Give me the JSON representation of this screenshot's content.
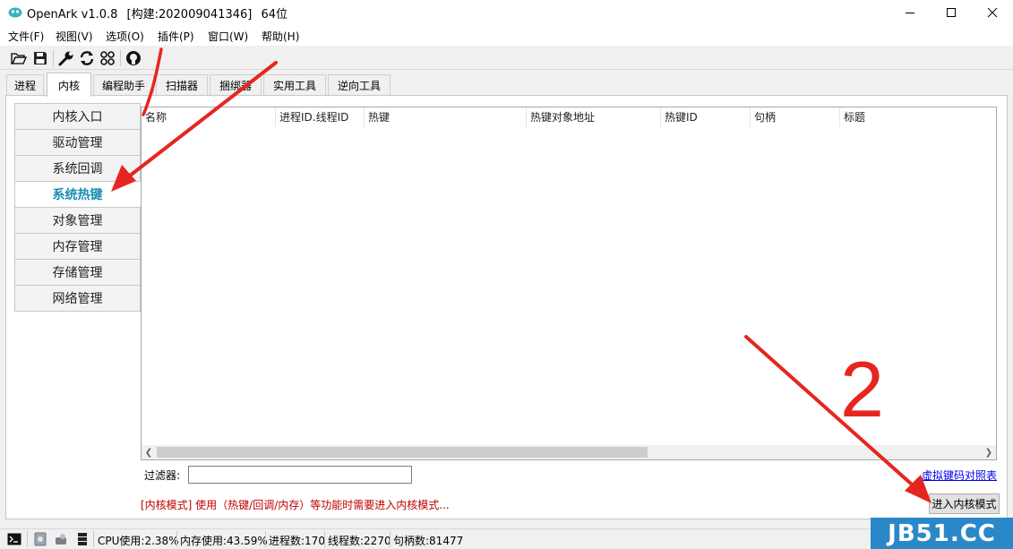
{
  "window": {
    "app_name": "OpenArk v1.0.8",
    "build": "[构建:202009041346]",
    "arch": "64位"
  },
  "menu": [
    "文件(F)",
    "视图(V)",
    "选项(O)",
    "插件(P)",
    "窗口(W)",
    "帮助(H)"
  ],
  "toolbar": {
    "icons": [
      "folder-open-icon",
      "save-icon",
      "wrench-icon",
      "refresh-icon",
      "grid-icon",
      "github-icon"
    ]
  },
  "tabs": [
    "进程",
    "内核",
    "编程助手",
    "扫描器",
    "捆绑器",
    "实用工具",
    "逆向工具"
  ],
  "active_tab": "内核",
  "sidebar": {
    "items": [
      "内核入口",
      "驱动管理",
      "系统回调",
      "系统热键",
      "对象管理",
      "内存管理",
      "存储管理",
      "网络管理"
    ],
    "active": "系统热键"
  },
  "list": {
    "columns": [
      "名称",
      "进程ID.线程ID",
      "热键",
      "热键对象地址",
      "热键ID",
      "句柄",
      "标题"
    ],
    "rows": []
  },
  "filter": {
    "label": "过滤器:",
    "value": ""
  },
  "vk_link": "虚拟键码对照表",
  "kernel_message": "[内核模式] 使用（热键/回调/内存）等功能时需要进入内核模式...",
  "kernel_button": "进入内核模式",
  "status": {
    "cpu": "CPU使用:2.38%",
    "memory": "内存使用:43.59%",
    "processes": "进程数:170",
    "threads": "线程数:2270",
    "handles": "句柄数:81477"
  },
  "watermark": "JB51.CC",
  "annotation_text": "2",
  "colors": {
    "active_sidebar": "#1a8cb4",
    "kernel_message": "#c00000",
    "annotation": "#e52620",
    "watermark_bg": "#2b88c8"
  }
}
